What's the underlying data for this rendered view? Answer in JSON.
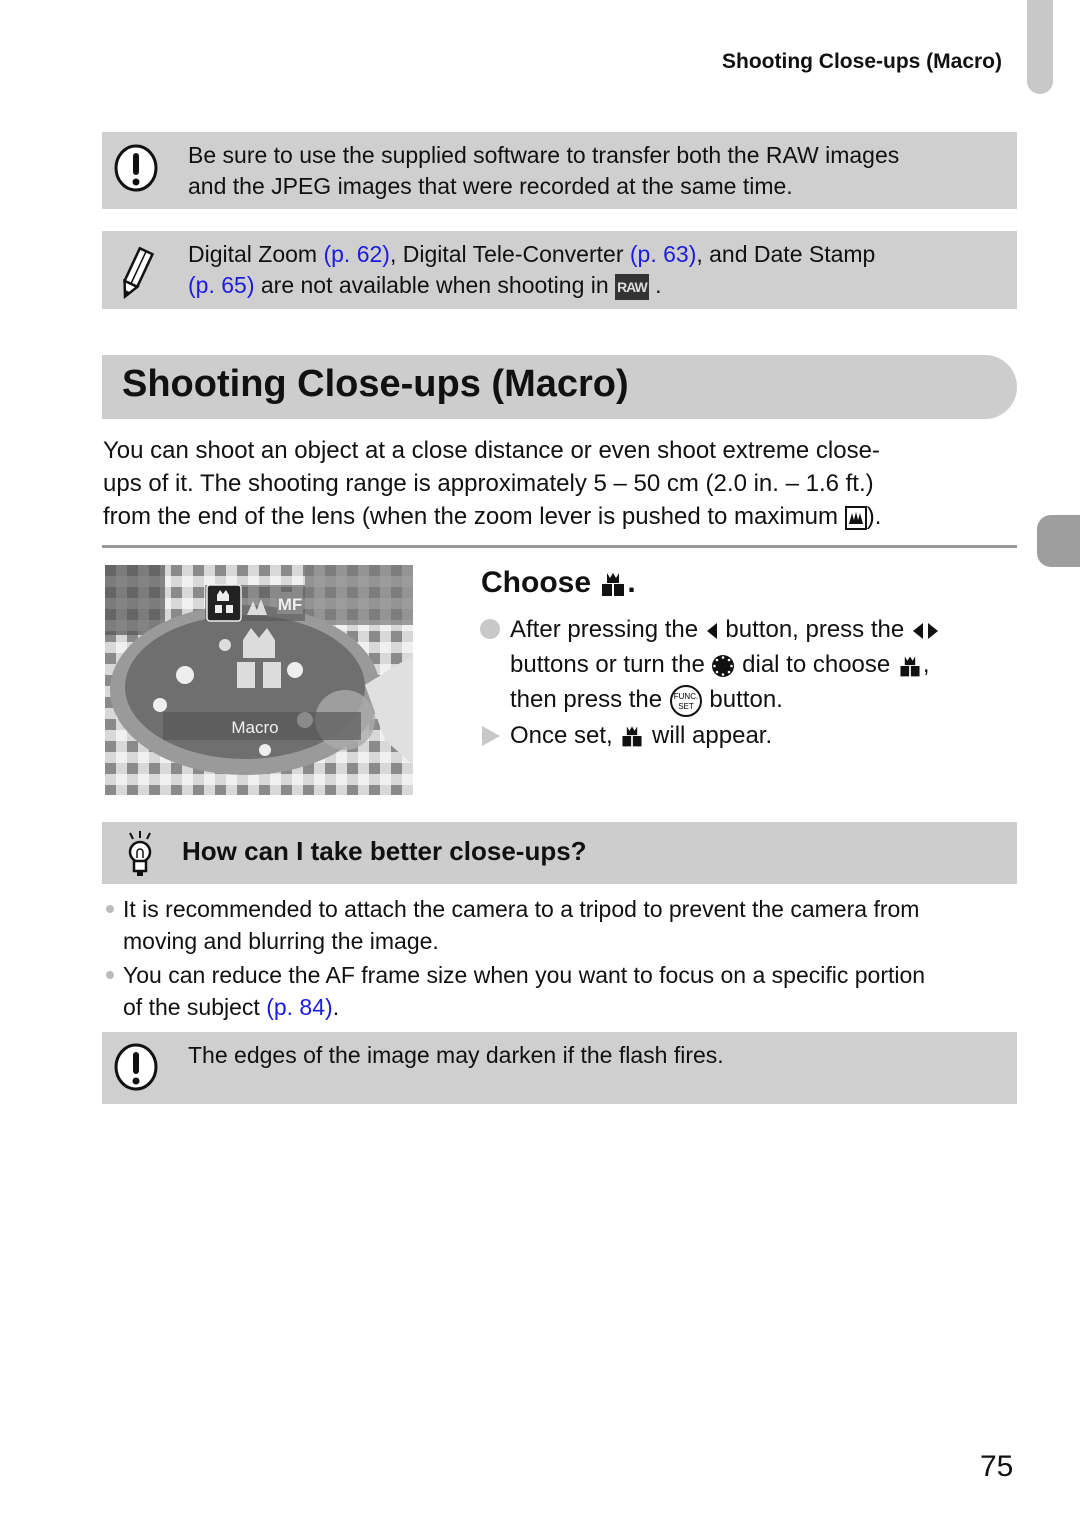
{
  "running_head": "Shooting Close-ups (Macro)",
  "notes": {
    "raw_caution": {
      "icon": "caution-icon",
      "line1": "Be sure to use the supplied software to transfer both the RAW images",
      "line2": "and the JPEG images that were recorded at the same time."
    },
    "memo": {
      "icon": "pencil-icon",
      "t1": "Digital Zoom ",
      "link1": "(p. 62)",
      "t2": ", Digital Tele-Converter ",
      "link2": "(p. 63)",
      "t3": ", and Date Stamp",
      "link3": "(p. 65)",
      "t4": " are not available when shooting in ",
      "raw_label": "RAW",
      "t5": " ."
    }
  },
  "section_title": "Shooting Close-ups (Macro)",
  "intro": {
    "line1": "You can shoot an object at a close distance or even shoot extreme close-",
    "line2": "ups of it. The shooting range is approximately 5 – 50 cm (2.0 in. – 1.6 ft.)",
    "line3a": "from the end of the lens (when the zoom lever is pushed to maximum ",
    "line3b": ")."
  },
  "photo": {
    "mode_icons": [
      "macro",
      "normal",
      "MF"
    ],
    "mf_label": "MF",
    "caption": "Macro"
  },
  "step": {
    "title": "Choose ",
    "title_end": ".",
    "items": [
      {
        "a": "After pressing the ",
        "b": " button, press the ",
        "c": "buttons or turn the ",
        "d": " dial to choose ",
        "e": ",",
        "f": "then press the ",
        "g": " button."
      },
      {
        "a": "Once set, ",
        "b": " will appear."
      }
    ]
  },
  "tip": {
    "title": "How can I take better close-ups?",
    "items": [
      {
        "l1": "It is recommended to attach the camera to a tripod to prevent the camera from",
        "l2": "moving and blurring the image."
      },
      {
        "l1": "You can reduce the AF frame size when you want to focus on a specific portion",
        "l2a": "of the subject ",
        "link": "(p. 84)",
        "l2b": "."
      }
    ]
  },
  "flash_caution": "The edges of the image may darken if the flash fires.",
  "page_number": "75"
}
